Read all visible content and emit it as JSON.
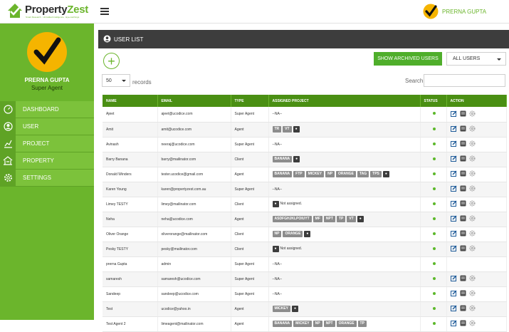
{
  "brand": {
    "name_part1": "Property",
    "name_part2": "Zest",
    "tagline": "Smart Research · Unrivalled Intelligence · Eye-catchings",
    "accent_color": "#6bb52c"
  },
  "header": {
    "user_name": "PRERNA GUPTA",
    "avatar_icon": "check-mark-avatar"
  },
  "sidebar": {
    "profile_name": "PRERNA GUPTA",
    "profile_role": "Super Agent",
    "items": [
      {
        "label": "DASHBOARD",
        "icon": "dashboard-gauge-icon"
      },
      {
        "label": "USER",
        "icon": "user-icon"
      },
      {
        "label": "PROJECT",
        "icon": "project-chart-icon"
      },
      {
        "label": "PROPERTY",
        "icon": "property-building-icon"
      },
      {
        "label": "SETTINGS",
        "icon": "settings-gear-icon"
      }
    ]
  },
  "panel": {
    "title": "USER LIST",
    "archived_button": "SHOW ARCHIVED USERS",
    "filter_value": "ALL USERS",
    "page_length": "50",
    "records_label": "records",
    "search_label": "Search:"
  },
  "table": {
    "columns": [
      "NAME",
      "EMAIL",
      "TYPE",
      "ASSIGNED PROJECT",
      "STATUS",
      "ACTION"
    ],
    "rows": [
      {
        "name": "Ajeet",
        "email": "ajeet@ucodice.com",
        "type": "Super Agent",
        "project_text": "--NA--",
        "chips": [],
        "actions": true
      },
      {
        "name": "Amit",
        "email": "amit@ucodice.com",
        "type": "Agent",
        "project_text": "",
        "chips": [
          "TR",
          "VT",
          "●"
        ],
        "actions": true
      },
      {
        "name": "Avinash",
        "email": "neeraj@ucodice.com",
        "type": "Super Agent",
        "project_text": "--NA--",
        "chips": [],
        "actions": true
      },
      {
        "name": "Barry Banana",
        "email": "barry@mailinator.com",
        "type": "Client",
        "project_text": "",
        "chips": [
          "BANANA",
          "●"
        ],
        "actions": true
      },
      {
        "name": "Donald Winders",
        "email": "tester.ucodice@gmail.com",
        "type": "Agent",
        "project_text": "",
        "chips": [
          "BANANA",
          "FTP",
          "MICKEY",
          "NP",
          "ORANGE",
          "TAG",
          "TPS",
          "●"
        ],
        "actions": true
      },
      {
        "name": "Karen Young",
        "email": "karen@propertyzest.com.au",
        "type": "Super Agent",
        "project_text": "--NA--",
        "chips": [],
        "actions": true
      },
      {
        "name": "Limey TESTY",
        "email": "limey@mailinator.com",
        "type": "Client",
        "project_text": "Not assigned.",
        "chips": [
          "●"
        ],
        "actions": true
      },
      {
        "name": "Neha",
        "email": "neha@ucodice.com",
        "type": "Agent",
        "project_text": "",
        "chips": [
          "ASDFGHJKLPOIUYT",
          "MF",
          "NPT",
          "TP",
          "VT",
          "●"
        ],
        "actions": true
      },
      {
        "name": "Oliver Orange",
        "email": "oliverorange@mailinator.com",
        "type": "Client",
        "project_text": "",
        "chips": [
          "NP",
          "ORANGE",
          "●"
        ],
        "actions": true
      },
      {
        "name": "Pesky TESTY",
        "email": "pesky@mailinator.com",
        "type": "Client",
        "project_text": "Not assigned.",
        "chips": [
          "●"
        ],
        "actions": true
      },
      {
        "name": "prerna Gupta",
        "email": "admin",
        "type": "Super Agent",
        "project_text": "--NA--",
        "chips": [],
        "actions": false
      },
      {
        "name": "samaresh",
        "email": "samaresh@ucodice.com",
        "type": "Super Agent",
        "project_text": "--NA--",
        "chips": [],
        "actions": true
      },
      {
        "name": "Sandeep",
        "email": "sandeep@ucodice.com",
        "type": "Super Agent",
        "project_text": "--NA--",
        "chips": [],
        "actions": true
      },
      {
        "name": "Test",
        "email": "ucodice@yahoo.in",
        "type": "Agent",
        "project_text": "",
        "chips": [
          "MICKEY",
          "●"
        ],
        "actions": true
      },
      {
        "name": "Test Agent 2",
        "email": "limeagent@mailinator.com",
        "type": "Agent",
        "project_text": "",
        "chips": [
          "BANANA",
          "MICKEY",
          "NP",
          "NPT",
          "ORANGE",
          "TP"
        ],
        "actions": true
      }
    ]
  }
}
